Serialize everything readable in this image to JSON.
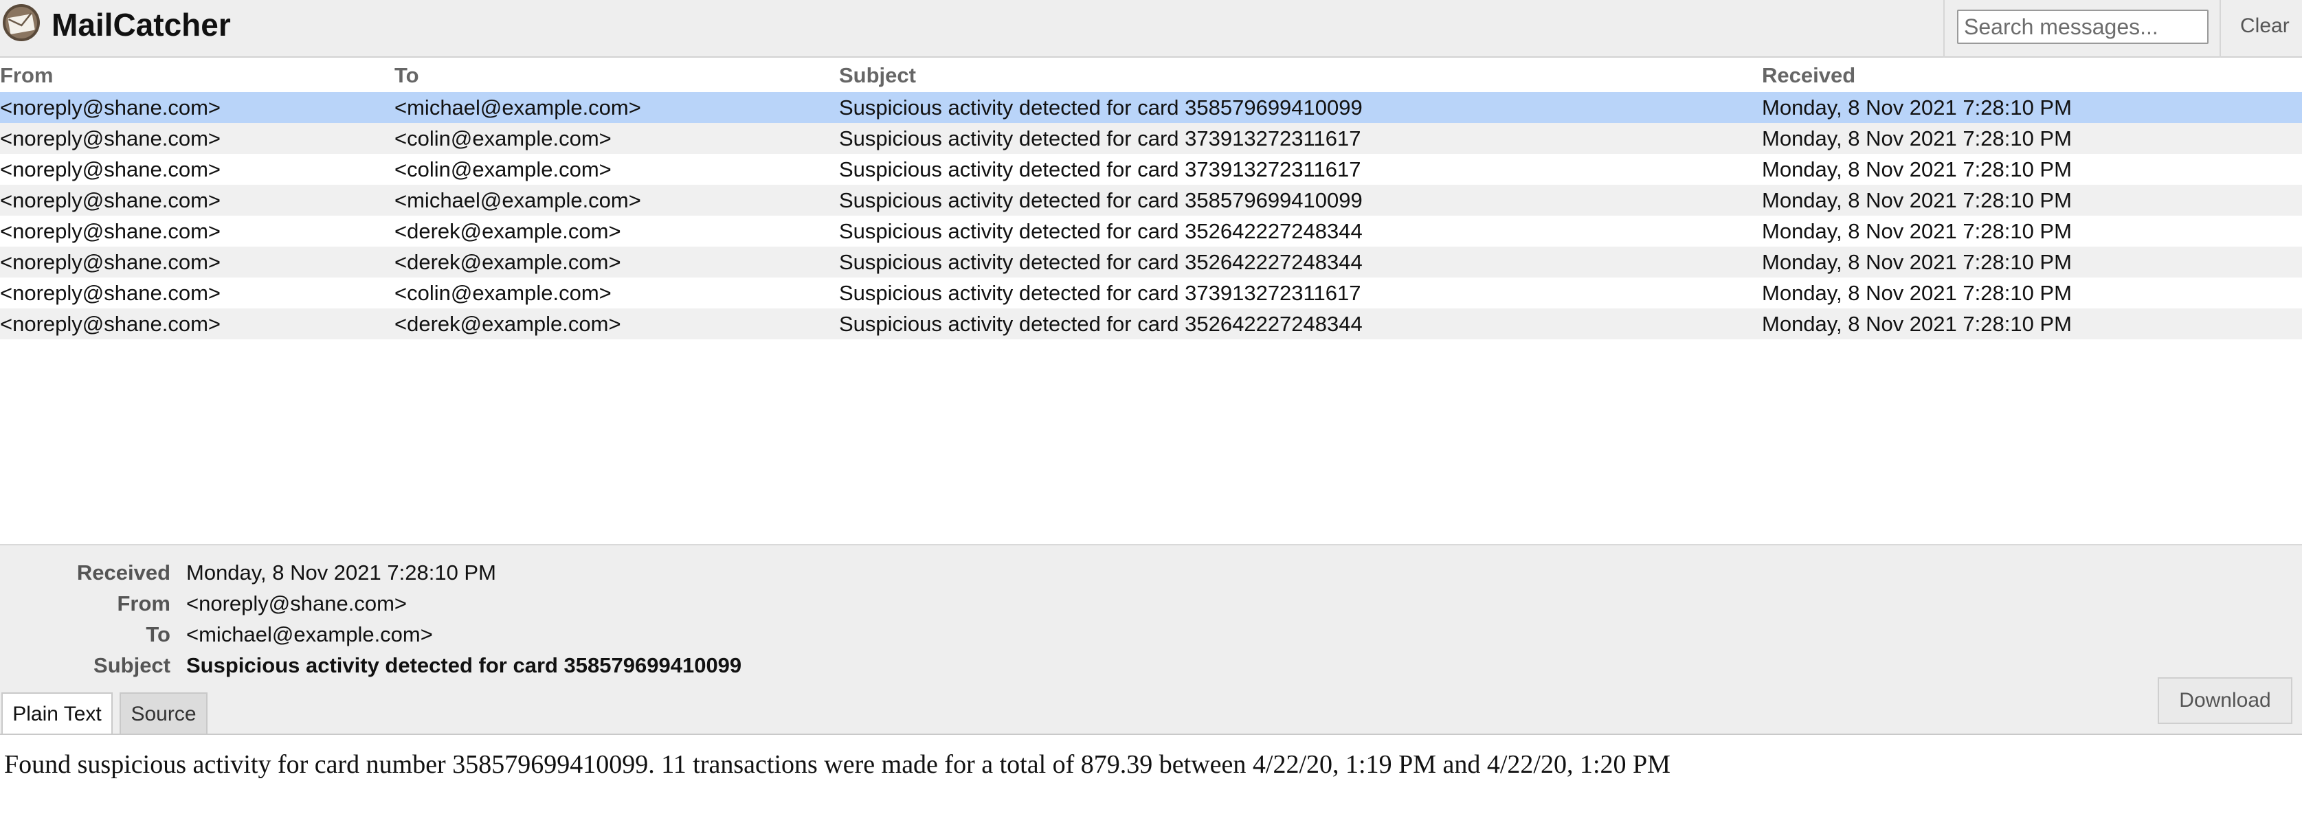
{
  "app": {
    "title": "MailCatcher"
  },
  "search": {
    "placeholder": "Search messages..."
  },
  "toolbar": {
    "clear_label": "Clear"
  },
  "list": {
    "columns": {
      "from": "From",
      "to": "To",
      "subject": "Subject",
      "received": "Received"
    },
    "rows": [
      {
        "from": "<noreply@shane.com>",
        "to": "<michael@example.com>",
        "subject": "Suspicious activity detected for card 358579699410099",
        "received": "Monday, 8 Nov 2021 7:28:10 PM"
      },
      {
        "from": "<noreply@shane.com>",
        "to": "<colin@example.com>",
        "subject": "Suspicious activity detected for card 373913272311617",
        "received": "Monday, 8 Nov 2021 7:28:10 PM"
      },
      {
        "from": "<noreply@shane.com>",
        "to": "<colin@example.com>",
        "subject": "Suspicious activity detected for card 373913272311617",
        "received": "Monday, 8 Nov 2021 7:28:10 PM"
      },
      {
        "from": "<noreply@shane.com>",
        "to": "<michael@example.com>",
        "subject": "Suspicious activity detected for card 358579699410099",
        "received": "Monday, 8 Nov 2021 7:28:10 PM"
      },
      {
        "from": "<noreply@shane.com>",
        "to": "<derek@example.com>",
        "subject": "Suspicious activity detected for card 352642227248344",
        "received": "Monday, 8 Nov 2021 7:28:10 PM"
      },
      {
        "from": "<noreply@shane.com>",
        "to": "<derek@example.com>",
        "subject": "Suspicious activity detected for card 352642227248344",
        "received": "Monday, 8 Nov 2021 7:28:10 PM"
      },
      {
        "from": "<noreply@shane.com>",
        "to": "<colin@example.com>",
        "subject": "Suspicious activity detected for card 373913272311617",
        "received": "Monday, 8 Nov 2021 7:28:10 PM"
      },
      {
        "from": "<noreply@shane.com>",
        "to": "<derek@example.com>",
        "subject": "Suspicious activity detected for card 352642227248344",
        "received": "Monday, 8 Nov 2021 7:28:10 PM"
      }
    ]
  },
  "detail": {
    "received_label": "Received",
    "received": "Monday, 8 Nov 2021 7:28:10 PM",
    "from_label": "From",
    "from": "<noreply@shane.com>",
    "to_label": "To",
    "to": "<michael@example.com>",
    "subject_label": "Subject",
    "subject": "Suspicious activity detected for card 358579699410099",
    "tabs": [
      "Plain Text",
      "Source"
    ],
    "download_label": "Download",
    "body": "Found suspicious activity for card number 358579699410099. 11 transactions were made for a total of 879.39 between 4/22/20, 1:19 PM and 4/22/20, 1:20 PM"
  },
  "colors": {
    "selected_row": "#b9d4f9",
    "header_bg": "#eeeeee",
    "stripe": "#f0f0f0"
  }
}
